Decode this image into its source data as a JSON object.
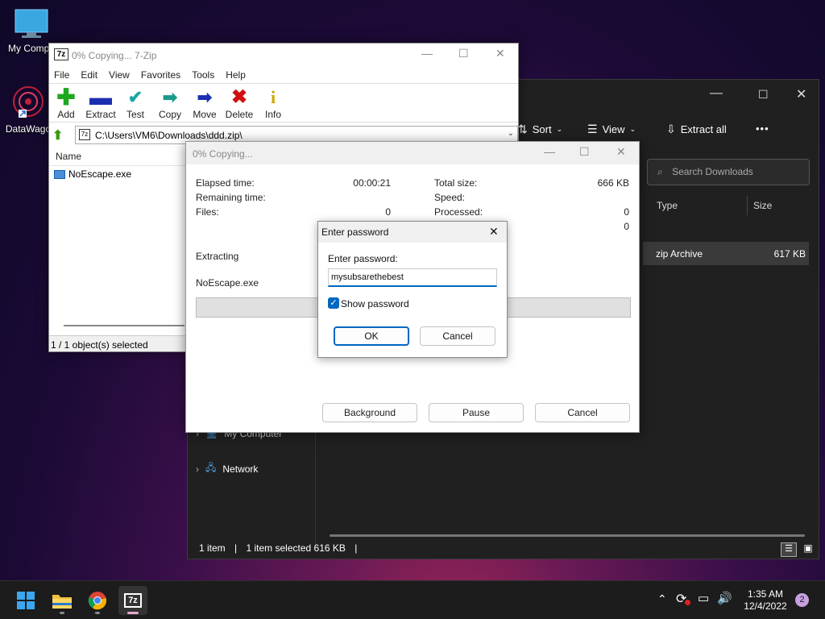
{
  "desktop": {
    "icons": [
      {
        "label": "My Compu"
      },
      {
        "label": "DataWago"
      }
    ]
  },
  "explorer": {
    "toolbar": {
      "sort": "Sort",
      "view": "View",
      "extract_all": "Extract all",
      "more": "•••"
    },
    "search_placeholder": "Search Downloads",
    "columns": {
      "type": "Type",
      "size": "Size"
    },
    "row": {
      "type": "zip Archive",
      "size": "617 KB"
    },
    "nav": {
      "my_computer": "My Computer",
      "network": "Network"
    },
    "status": {
      "count": "1 item",
      "selected": "1 item selected  616 KB"
    }
  },
  "sevenzip": {
    "title": "0% Copying... 7-Zip",
    "app_icon": "7z",
    "menu": [
      "File",
      "Edit",
      "View",
      "Favorites",
      "Tools",
      "Help"
    ],
    "toolbar": {
      "add": "Add",
      "extract": "Extract",
      "test": "Test",
      "copy": "Copy",
      "move": "Move",
      "delete": "Delete",
      "info": "Info"
    },
    "path": "C:\\Users\\VM6\\Downloads\\ddd.zip\\",
    "column_name": "Name",
    "file": "NoEscape.exe",
    "status": "1 / 1 object(s) selected"
  },
  "copying": {
    "title": "0% Copying...",
    "elapsed_label": "Elapsed time:",
    "elapsed_value": "00:00:21",
    "remaining_label": "Remaining time:",
    "files_label": "Files:",
    "files_value": "0",
    "total_size_label": "Total size:",
    "total_size_value": "666 KB",
    "speed_label": "Speed:",
    "processed_label": "Processed:",
    "processed_value": "0",
    "extra_value": "0",
    "action": "Extracting",
    "current_file": "NoEscape.exe",
    "buttons": {
      "background": "Background",
      "pause": "Pause",
      "cancel": "Cancel"
    }
  },
  "password_dialog": {
    "title": "Enter password",
    "close": "✕",
    "label": "Enter password:",
    "value": "mysubsarethebest",
    "show_password": "Show password",
    "ok": "OK",
    "cancel": "Cancel"
  },
  "taskbar": {
    "time": "1:35 AM",
    "date": "12/4/2022",
    "notifications": "2",
    "sevenzip_label": "7z"
  }
}
